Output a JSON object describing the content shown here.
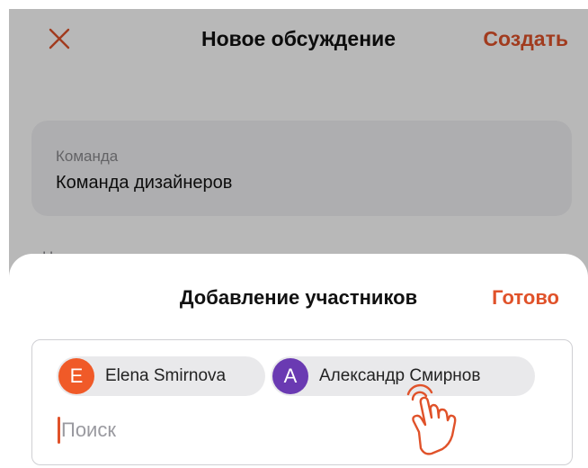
{
  "colors": {
    "accent": "#e0522a",
    "avatar_e": "#f05a28",
    "avatar_a": "#6a3ab2"
  },
  "nav": {
    "close_icon": "close-icon",
    "title": "Новое обсуждение",
    "create_label": "Создать"
  },
  "form": {
    "team_label": "Команда",
    "team_value": "Команда дизайнеров",
    "name_label": "Название"
  },
  "sheet": {
    "title": "Добавление участников",
    "done_label": "Готово",
    "chips": [
      {
        "initial": "E",
        "name": "Elena Smirnova"
      },
      {
        "initial": "A",
        "name": "Александр Смирнов"
      }
    ],
    "search_placeholder": "Поиск"
  },
  "gesture": {
    "icon": "tap-hand-icon"
  }
}
